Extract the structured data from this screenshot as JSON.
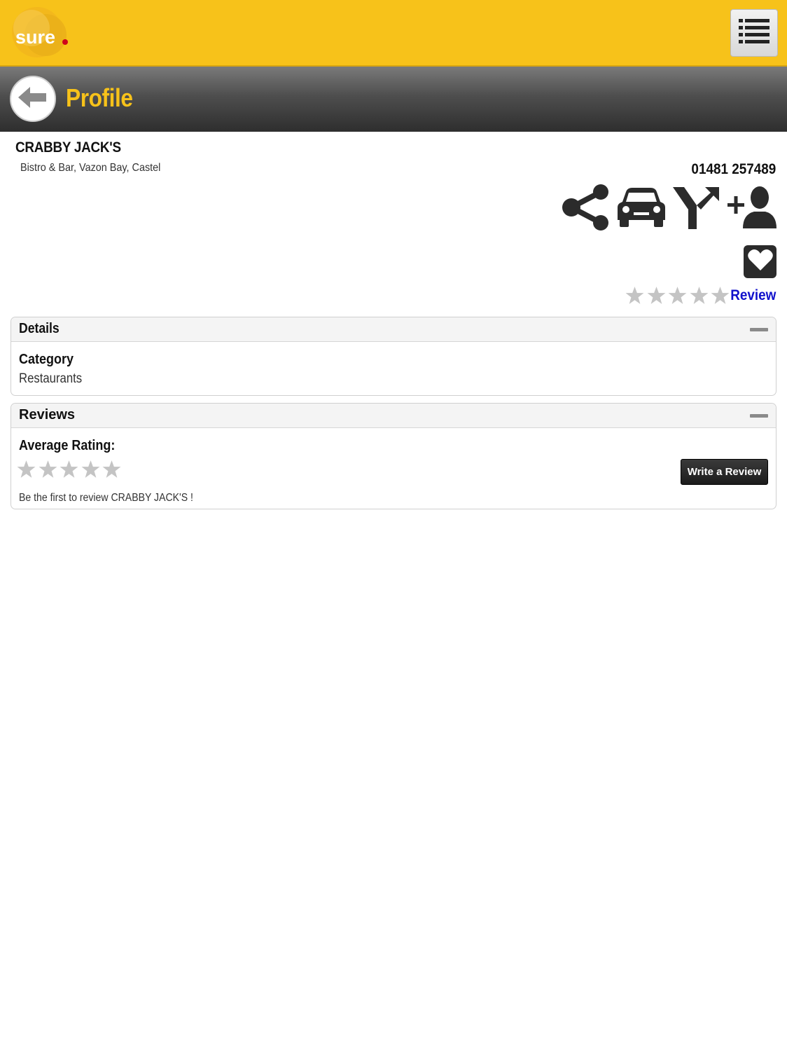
{
  "header": {
    "logo_text": "sure",
    "menu_icon": "list-menu-icon",
    "brand_color": "#f7c21a"
  },
  "titlebar": {
    "back_icon": "back-arrow-icon",
    "title": "Profile"
  },
  "business": {
    "name": "CRABBY JACK'S",
    "subtitle": "Bistro & Bar, Vazon Bay, Castel",
    "phone": "01481 257489"
  },
  "actions": [
    {
      "name": "share",
      "icon": "share-icon"
    },
    {
      "name": "drive",
      "icon": "car-icon"
    },
    {
      "name": "directions",
      "icon": "directions-fork-icon"
    },
    {
      "name": "add-contact",
      "icon": "add-contact-icon"
    }
  ],
  "favorite_icon": "heart-icon",
  "rating": {
    "stars_total": 5,
    "stars_filled": 0,
    "review_link": "Review"
  },
  "details_panel": {
    "title": "Details",
    "category_label": "Category",
    "category_value": "Restaurants"
  },
  "reviews_panel": {
    "title": "Reviews",
    "average_label": "Average Rating:",
    "average_stars_filled": 0,
    "first_review_text": "Be the first to review CRABBY JACK'S !",
    "write_review_label": "Write a Review"
  }
}
